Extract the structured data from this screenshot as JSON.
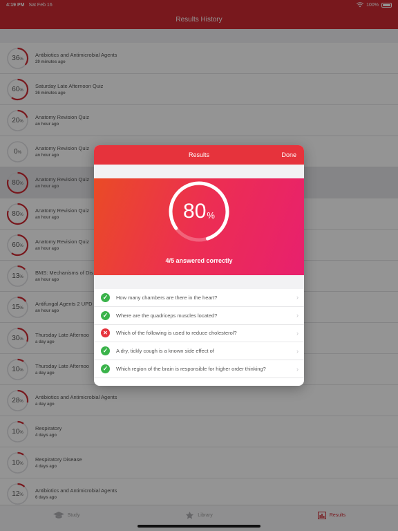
{
  "status": {
    "time": "4:19 PM",
    "date": "Sat Feb 16",
    "battery": "100%"
  },
  "nav": {
    "title": "Results History"
  },
  "history": [
    {
      "score": "36",
      "title": "Antibiotics and Antimicrobial Agents",
      "time": "29 minutes ago"
    },
    {
      "score": "60",
      "title": "Saturday Late Afternoon Quiz",
      "time": "36 minutes ago"
    },
    {
      "score": "20",
      "title": "Anatomy Revision Quiz",
      "time": "an hour ago"
    },
    {
      "score": "0",
      "title": "Anatomy Revision Quiz",
      "time": "an hour ago"
    },
    {
      "score": "80",
      "title": "Anatomy Revision Quiz",
      "time": "an hour ago",
      "selected": true
    },
    {
      "score": "80",
      "title": "Anatomy Revision Quiz",
      "time": "an hour ago"
    },
    {
      "score": "60",
      "title": "Anatomy Revision Quiz",
      "time": "an hour ago"
    },
    {
      "score": "13",
      "title": "BMS: Mechanisms of Dis",
      "time": "an hour ago"
    },
    {
      "score": "15",
      "title": "Antifungal Agents 2 UPD",
      "time": "an hour ago"
    },
    {
      "score": "30",
      "title": "Thursday Late Afternoo",
      "time": "a day ago"
    },
    {
      "score": "10",
      "title": "Thursday Late Afternoo",
      "time": "a day ago"
    },
    {
      "score": "28",
      "title": "Antibiotics and Antimicrobial Agents",
      "time": "a day ago"
    },
    {
      "score": "10",
      "title": "Respiratory",
      "time": "4 days ago"
    },
    {
      "score": "10",
      "title": "Respiratory Disease",
      "time": "4 days ago"
    },
    {
      "score": "12",
      "title": "Antibiotics and Antimicrobial Agents",
      "time": "6 days ago"
    }
  ],
  "percent_sign": "%",
  "tabs": [
    {
      "label": "Study",
      "icon": "graduation-cap-icon"
    },
    {
      "label": "Library",
      "icon": "star-icon"
    },
    {
      "label": "Results",
      "icon": "bar-chart-icon",
      "active": true
    }
  ],
  "modal": {
    "title": "Results",
    "done_label": "Done",
    "score": "80",
    "score_fraction": 0.8,
    "answered": "4/5 answered correctly",
    "questions": [
      {
        "text": "How many chambers are there in the heart?",
        "correct": true
      },
      {
        "text": "Where are the quadriceps muscles located?",
        "correct": true
      },
      {
        "text": "Which of the following is used to reduce cholesterol?",
        "correct": false
      },
      {
        "text": "A dry, tickly cough is a known side effect of",
        "correct": true
      },
      {
        "text": "Which region of the brain is responsible for higher order thinking?",
        "correct": true
      }
    ]
  },
  "colors": {
    "brand_red": "#cf2a33",
    "accent": "#e6333c",
    "correct_green": "#3ab34a",
    "ring_track": "#e0e0e3"
  }
}
